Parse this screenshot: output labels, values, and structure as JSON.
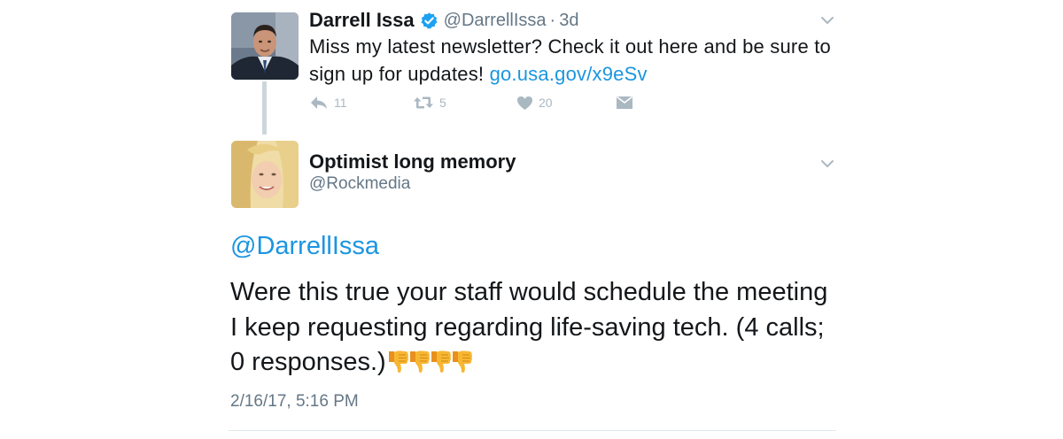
{
  "parent_tweet": {
    "display_name": "Darrell Issa",
    "verified": true,
    "screen_name": "@DarrellIssa",
    "separator": "·",
    "time_ago": "3d",
    "text_before_link": "Miss my latest newsletter? Check it out here and be sure to sign up for updates! ",
    "link_text": "go.usa.gov/x9eSv",
    "actions": {
      "reply_count": "11",
      "retweet_count": "5",
      "like_count": "20"
    },
    "icons": {
      "avatar": "avatar-photo-man-suit",
      "verified": "verified-badge-icon",
      "caret": "chevron-down-icon",
      "reply": "reply-icon",
      "retweet": "retweet-icon",
      "like": "heart-icon",
      "dm": "envelope-icon"
    }
  },
  "reply_tweet": {
    "display_name": "Optimist long memory",
    "screen_name": "@Rockmedia",
    "mention": "@DarrellIssa",
    "body_text": "Were this true your staff would schedule the meeting I keep requesting regarding life-saving tech. (4 calls; 0 responses.)",
    "emoji": [
      "thumbs-down",
      "thumbs-down",
      "thumbs-down",
      "thumbs-down"
    ],
    "timestamp": "2/16/17, 5:16 PM",
    "icons": {
      "avatar": "avatar-photo-woman-blonde",
      "caret": "chevron-down-icon",
      "emoji": "thumbs-down-icon"
    }
  },
  "colors": {
    "text": "#14171a",
    "secondary_text": "#657786",
    "link": "#1b95e0",
    "verified": "#1da1f2",
    "action_icon": "#aab8c2",
    "thread_line": "#ccd6dd",
    "emoji_yellow": "#f5a623"
  }
}
